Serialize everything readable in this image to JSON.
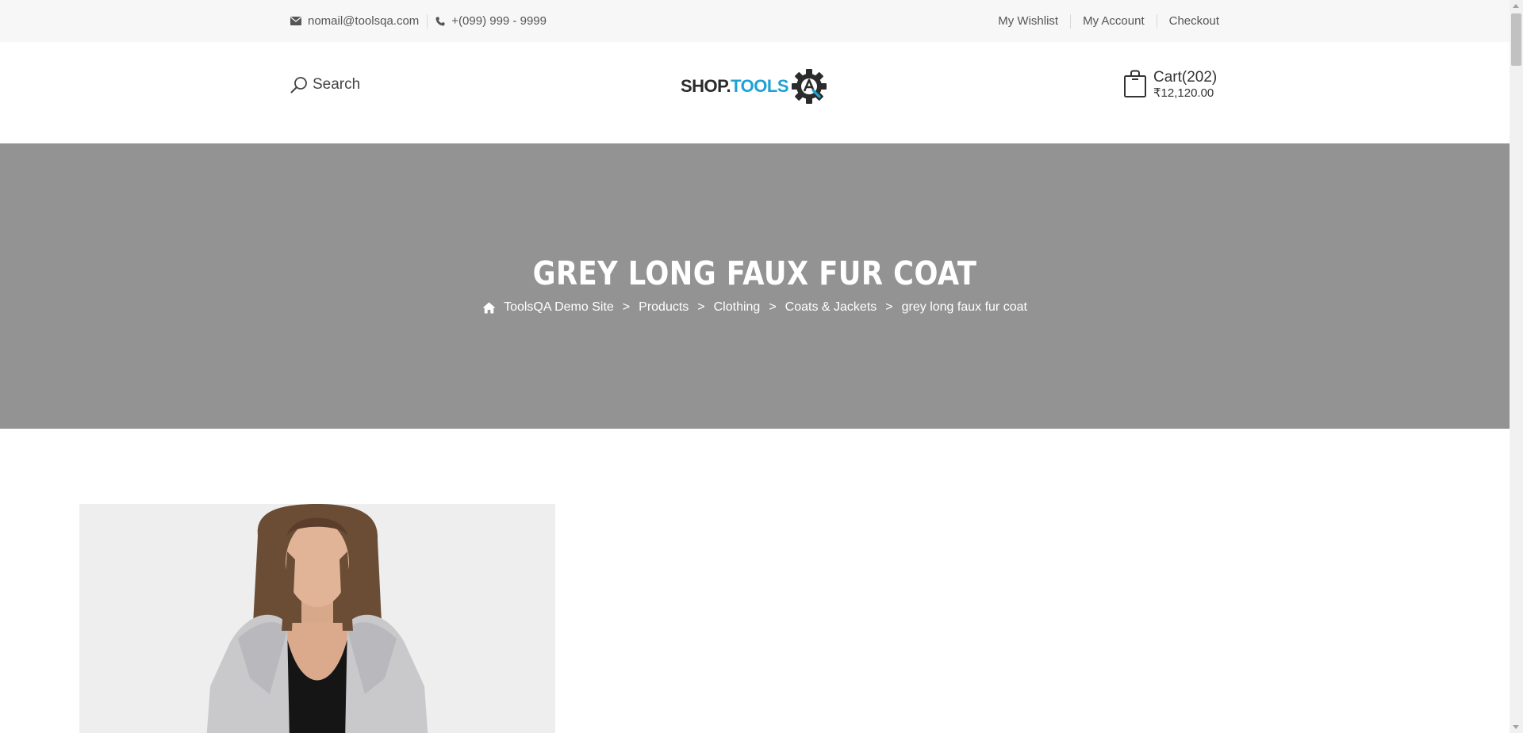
{
  "topbar": {
    "email": "nomail@toolsqa.com",
    "phone": "+(099) 999 - 9999",
    "links": [
      "My Wishlist",
      "My Account",
      "Checkout"
    ]
  },
  "header": {
    "search_label": "Search",
    "logo": {
      "shop": "SHOP.",
      "tools": "TOOLS",
      "badge": "QA"
    },
    "cart": {
      "label": "Cart(202)",
      "total": "₹12,120.00"
    }
  },
  "hero": {
    "title": "GREY LONG FAUX FUR COAT",
    "breadcrumbs": [
      "ToolsQA Demo Site",
      "Products",
      "Clothing",
      "Coats & Jackets"
    ],
    "current": "grey long faux fur coat",
    "separator": ">"
  },
  "colors": {
    "accent": "#1fa1d6",
    "hero_bg": "#939393",
    "topbar_bg": "#f7f7f7"
  },
  "icons": {
    "email": "envelope-icon",
    "phone": "phone-icon",
    "search": "search-icon",
    "cart": "shopping-bag-icon",
    "home": "home-icon",
    "logo": "gear-icon"
  }
}
